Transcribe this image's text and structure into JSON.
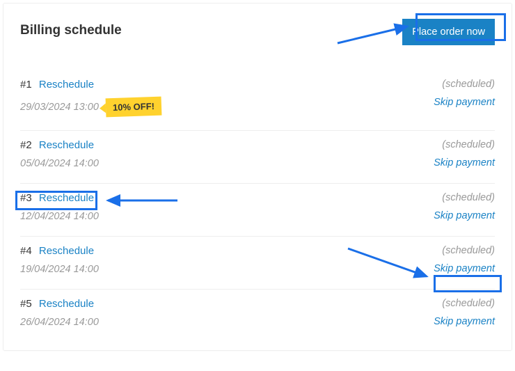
{
  "header": {
    "title": "Billing schedule",
    "place_order_label": "Place order now"
  },
  "schedule": [
    {
      "num": "#1",
      "reschedule_label": "Reschedule",
      "date": "29/03/2024 13:00",
      "badge": "10% OFF!",
      "status": "(scheduled)",
      "skip_label": "Skip payment"
    },
    {
      "num": "#2",
      "reschedule_label": "Reschedule",
      "date": "05/04/2024 14:00",
      "badge": null,
      "status": "(scheduled)",
      "skip_label": "Skip payment"
    },
    {
      "num": "#3",
      "reschedule_label": "Reschedule",
      "date": "12/04/2024 14:00",
      "badge": null,
      "status": "(scheduled)",
      "skip_label": "Skip payment"
    },
    {
      "num": "#4",
      "reschedule_label": "Reschedule",
      "date": "19/04/2024 14:00",
      "badge": null,
      "status": "(scheduled)",
      "skip_label": "Skip payment"
    },
    {
      "num": "#5",
      "reschedule_label": "Reschedule",
      "date": "26/04/2024 14:00",
      "badge": null,
      "status": "(scheduled)",
      "skip_label": "Skip payment"
    }
  ]
}
